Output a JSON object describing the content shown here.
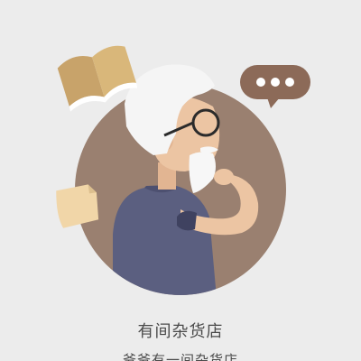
{
  "app": {
    "title": "有间杂货店",
    "subtitle": "爷爷有一间杂货店"
  },
  "icons": {
    "book": "book-icon",
    "speech_bubble": "speech-bubble-icon",
    "letter": "letter-icon",
    "avatar": "elderly-man-avatar"
  },
  "colors": {
    "background": "#ececec",
    "circle": "#9a8070",
    "sweater": "#5b5f80",
    "skin": "#ecc5a3",
    "hair": "#f5f5f5",
    "text": "#4a4a4a"
  }
}
